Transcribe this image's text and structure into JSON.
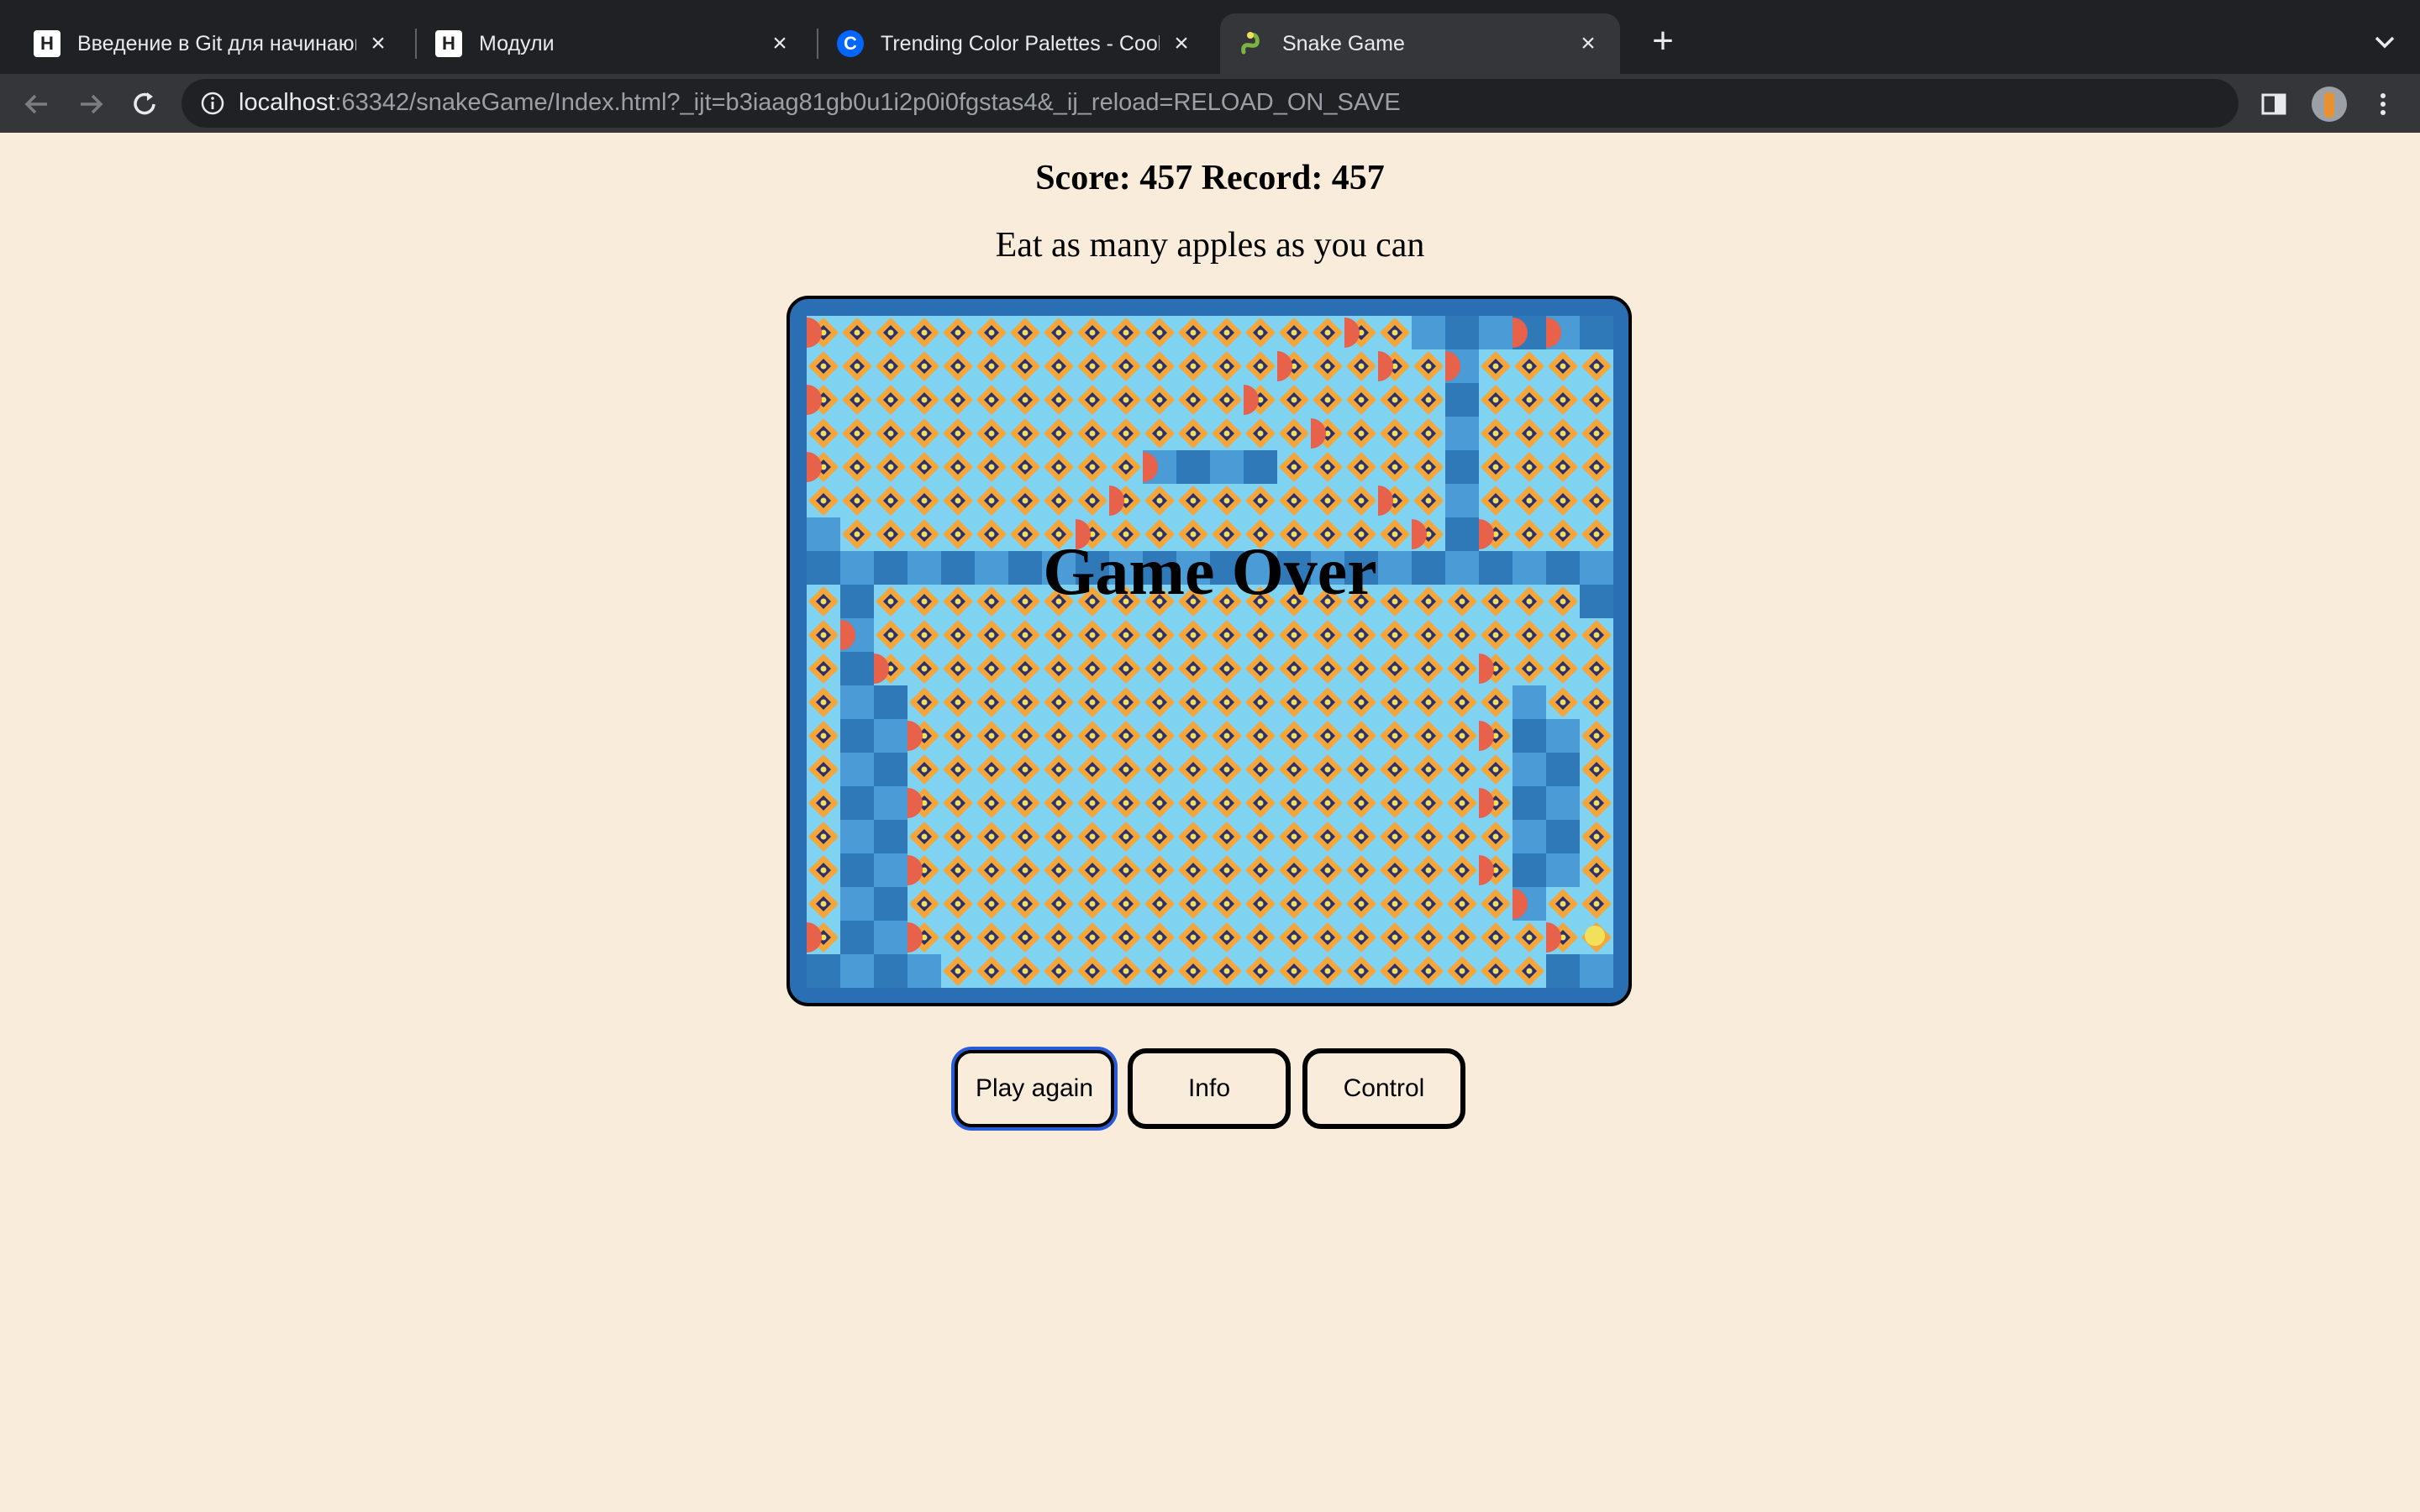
{
  "browser": {
    "tabs": [
      {
        "title": "Введение в Git для начинающ",
        "favicon": "hexlet-icon",
        "active": false
      },
      {
        "title": "Модули",
        "favicon": "hexlet-icon",
        "active": false
      },
      {
        "title": "Trending Color Palettes - Coolo",
        "favicon": "coolors-icon",
        "active": false
      },
      {
        "title": "Snake Game",
        "favicon": "snake-icon",
        "active": true
      }
    ],
    "url_host": "localhost",
    "url_rest": ":63342/snakeGame/Index.html?_ijt=b3iaag81gb0u1i2p0i0fgstas4&_ij_reload=RELOAD_ON_SAVE"
  },
  "game": {
    "score_line": "Score: 457 Record: 457",
    "subtitle": "Eat as many apples as you can",
    "game_over": "Game Over",
    "board_cols": 24,
    "board_rows": 20,
    "colors": {
      "tile_light": "#4a9bd6",
      "tile_dark": "#2f79b8",
      "snake_orange": "#f4a63a",
      "snake_navy": "#2b2f6b",
      "snake_yellow": "#f3e05a",
      "snake_cyan": "#7fd3f0",
      "turn_red": "#e8614a"
    },
    "buttons": {
      "play_again": "Play again",
      "info": "Info",
      "control": "Control"
    }
  }
}
